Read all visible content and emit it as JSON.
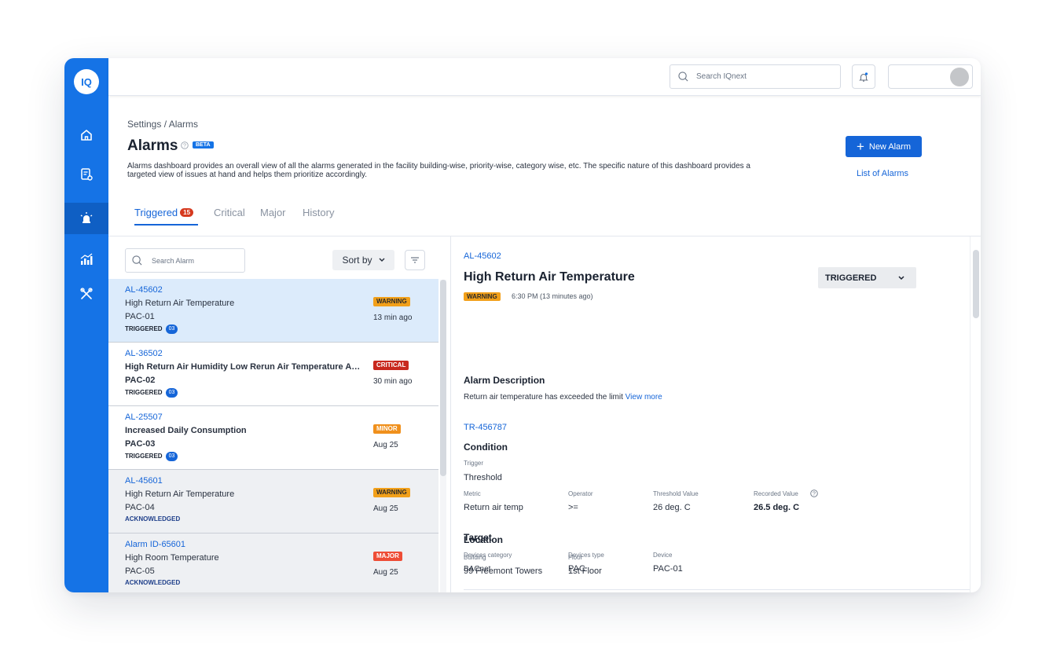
{
  "app": {
    "logo_text": "IQ"
  },
  "topbar": {
    "search_placeholder": "Search IQnext"
  },
  "header": {
    "breadcrumb": "Settings / Alarms",
    "title": "Alarms",
    "beta": "BETA",
    "description": "Alarms dashboard provides an overall view of all the alarms generated in the facility building-wise, priority-wise, category wise, etc. The specific nature of this dashboard provides a targeted view of issues at hand and helps them prioritize accordingly.",
    "new_alarm": "New Alarm",
    "list_alarms": "List of Alarms"
  },
  "tabs": [
    {
      "label": "Triggered",
      "badge": "15"
    },
    {
      "label": "Critical"
    },
    {
      "label": "Major"
    },
    {
      "label": "History"
    }
  ],
  "list": {
    "search_placeholder": "Search Alarm",
    "sort_label": "Sort by",
    "items": [
      {
        "id": "AL-45602",
        "title": "High Return Air Temperature",
        "device": "PAC-01",
        "status": "TRIGGERED",
        "count": "03",
        "severity": "WARNING",
        "time": "13 min ago"
      },
      {
        "id": "AL-36502",
        "title": "High Return Air Humidity Low Rerun Air Temperature Air...",
        "device": "PAC-02",
        "status": "TRIGGERED",
        "count": "03",
        "severity": "CRITICAL",
        "time": "30 min ago"
      },
      {
        "id": "AL-25507",
        "title": "Increased Daily Consumption",
        "device": "PAC-03",
        "status": "TRIGGERED",
        "count": "03",
        "severity": "MINOR",
        "time": "Aug 25"
      },
      {
        "id": "AL-45601",
        "title": "High Return Air Temperature",
        "device": "PAC-04",
        "status": "ACKNOWLEDGED",
        "severity": "WARNING",
        "time": "Aug 25"
      },
      {
        "id": "Alarm ID-65601",
        "title": "High Room Temperature",
        "device": "PAC-05",
        "status": "ACKNOWLEDGED",
        "severity": "MAJOR",
        "time": "Aug 25"
      }
    ]
  },
  "detail": {
    "id": "AL-45602",
    "title": "High Return Air Temperature",
    "status": "TRIGGERED",
    "severity": "WARNING",
    "time": "6:30 PM (13 minutes ago)",
    "desc_heading": "Alarm Description",
    "desc_text": "Return air temperature has exceeded the limit",
    "view_more": "View more",
    "tr_id": "TR-456787",
    "condition": {
      "heading": "Condition",
      "trigger_label": "Trigger",
      "trigger_value": "Threshold",
      "metric_label": "Metric",
      "metric_value": "Return air temp",
      "operator_label": "Operator",
      "operator_value": ">=",
      "threshold_label": "Threshold Value",
      "threshold_value": "26 deg. C",
      "recorded_label": "Recorded Value",
      "recorded_value": "26.5 deg. C"
    },
    "target": {
      "heading": "Target",
      "category_label": "Devices category",
      "category_value": "BACnet",
      "type_label": "Devices type",
      "type_value": "PAC",
      "device_label": "Device",
      "device_value": "PAC-01"
    },
    "location": {
      "heading": "Location",
      "building_label": "Building",
      "building_value": "99 Freemont Towers",
      "floor_label": "Floor",
      "floor_value": "1st Floor"
    }
  },
  "colors": {
    "primary": "#1573e6",
    "warning": "#f2a01a",
    "critical": "#c8281e",
    "minor": "#f0901c",
    "major": "#ee4d36"
  }
}
